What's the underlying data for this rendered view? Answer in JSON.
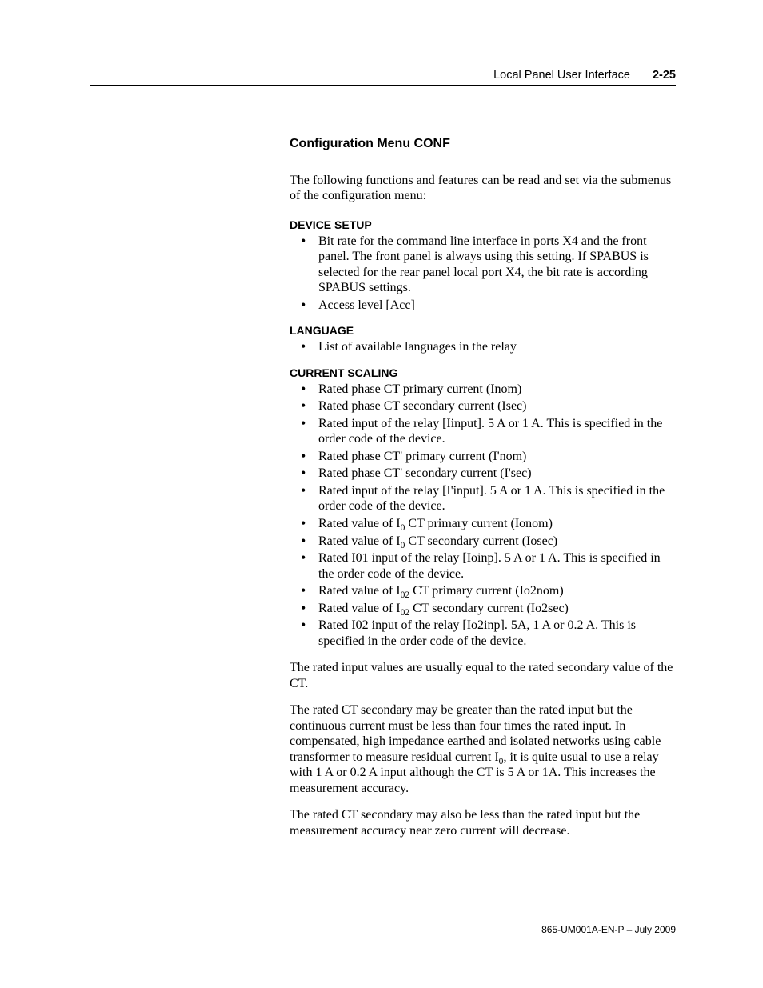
{
  "header": {
    "title": "Local Panel User Interface",
    "page": "2-25"
  },
  "section_title": "Configuration Menu CONF",
  "intro": "The following functions and features can be read and set via the submenus of the configuration menu:",
  "device_setup": {
    "heading": "DEVICE SETUP",
    "items": [
      "Bit rate for the command line interface in ports X4 and the front panel.  The front panel is always using this setting.  If SPABUS is selected for the rear panel local port X4, the bit rate is according SPABUS settings.",
      "Access level [Acc]"
    ]
  },
  "language": {
    "heading": "LANGUAGE",
    "items": [
      "List of available languages in the relay"
    ]
  },
  "current_scaling": {
    "heading": "CURRENT SCALING",
    "items": [
      "Rated phase CT primary current (Inom)",
      "Rated phase CT secondary current (Isec)",
      "Rated input of the relay [Iinput]. 5 A or 1 A. This is specified in the order code of the device.",
      "Rated phase CT' primary current (I'nom)",
      "Rated phase CT' secondary current (I'sec)",
      "Rated input of the relay [I'input]. 5 A or 1 A. This is specified in the order code of the device.",
      "Rated value of I_0 CT primary current (Ionom)",
      "Rated value of I_0 CT secondary current (Iosec)",
      "Rated I01 input of the relay [Ioinp]. 5 A or 1 A. This is specified in the order code of the device.",
      "Rated value of I_02 CT primary current (Io2nom)",
      "Rated value of I_02 CT secondary current (Io2sec)",
      "Rated I02 input of the relay [Io2inp]. 5A, 1 A or 0.2 A.  This is specified in the order code of the device."
    ]
  },
  "paragraphs": [
    "The rated input values are usually equal to the rated secondary value of the CT.",
    "The rated CT secondary may be greater than the rated input but the continuous current must be less than four times the rated input. In compensated, high impedance earthed and isolated networks using cable transformer to measure residual current I_0, it is quite usual to use a relay with 1 A or 0.2 A input although the CT is 5 A or 1A. This increases the measurement accuracy.",
    "The rated CT secondary may also be less than the rated input but the measurement accuracy near zero current will decrease."
  ],
  "footer": "865-UM001A-EN-P – July 2009"
}
